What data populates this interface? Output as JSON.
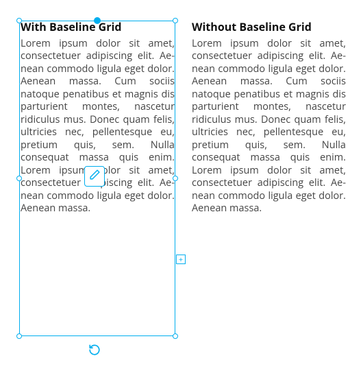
{
  "columns": {
    "left": {
      "heading": "With Baseline Grid",
      "body": "Lorem ipsum dolor sit amet, consectetuer adipiscing elit. Ae­nean commodo ligula eget do­lor. Aenean massa. Cum sociis natoque penatibus et magnis dis parturient montes, nasce­tur ridiculus mus. Donec quam felis, ultricies nec, pellentesque eu, pretium quis, sem. Nulla consequat massa quis enim. Lorem ipsum dolor sit amet, consectetuer adipiscing elit. Ae­nean commodo ligula eget do­lor. Aenean massa."
    },
    "right": {
      "heading": "Without Baseline Grid",
      "body": "Lorem ipsum dolor sit amet, consectetuer adipiscing elit. Ae­nean commodo ligula eget do­lor. Aenean massa. Cum sociis natoque penatibus et magnis dis parturient montes, nasce­tur ridiculus mus. Donec quam felis, ultricies nec, pellentesque eu, pretium quis, sem. Nulla consequat massa quis enim. Lorem ipsum dolor sit amet, consectetuer adipiscing elit. Ae­nean commodo ligula eget do­lor. Aenean massa."
    }
  },
  "controls": {
    "plus_glyph": "+"
  },
  "colors": {
    "selection": "#00AEEF",
    "text": "#333333"
  }
}
